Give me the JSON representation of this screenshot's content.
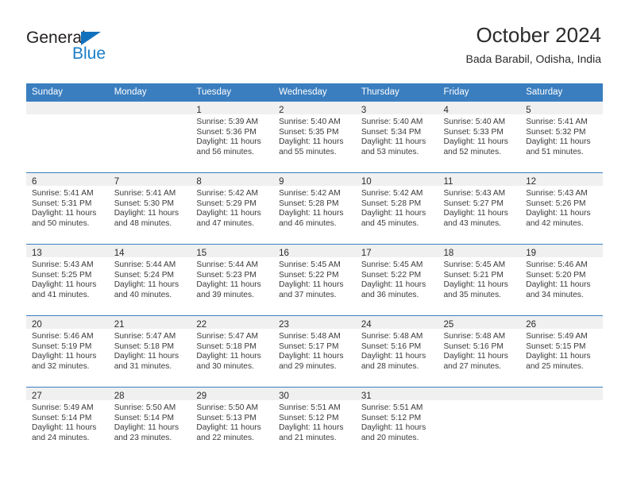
{
  "brand": {
    "name_top": "General",
    "name_bottom": "Blue",
    "triangle_color": "#1271bd",
    "blue_text_color": "#1a7ec6"
  },
  "header": {
    "title": "October 2024",
    "subtitle": "Bada Barabil, Odisha, India",
    "accent_color": "#3a7ebf",
    "band_color": "#f0f0f0"
  },
  "weekday_headers": [
    "Sunday",
    "Monday",
    "Tuesday",
    "Wednesday",
    "Thursday",
    "Friday",
    "Saturday"
  ],
  "weeks": [
    [
      {
        "day": ""
      },
      {
        "day": ""
      },
      {
        "day": "1",
        "sunrise": "Sunrise: 5:39 AM",
        "sunset": "Sunset: 5:36 PM",
        "daylight_line1": "Daylight: 11 hours",
        "daylight_line2": "and 56 minutes."
      },
      {
        "day": "2",
        "sunrise": "Sunrise: 5:40 AM",
        "sunset": "Sunset: 5:35 PM",
        "daylight_line1": "Daylight: 11 hours",
        "daylight_line2": "and 55 minutes."
      },
      {
        "day": "3",
        "sunrise": "Sunrise: 5:40 AM",
        "sunset": "Sunset: 5:34 PM",
        "daylight_line1": "Daylight: 11 hours",
        "daylight_line2": "and 53 minutes."
      },
      {
        "day": "4",
        "sunrise": "Sunrise: 5:40 AM",
        "sunset": "Sunset: 5:33 PM",
        "daylight_line1": "Daylight: 11 hours",
        "daylight_line2": "and 52 minutes."
      },
      {
        "day": "5",
        "sunrise": "Sunrise: 5:41 AM",
        "sunset": "Sunset: 5:32 PM",
        "daylight_line1": "Daylight: 11 hours",
        "daylight_line2": "and 51 minutes."
      }
    ],
    [
      {
        "day": "6",
        "sunrise": "Sunrise: 5:41 AM",
        "sunset": "Sunset: 5:31 PM",
        "daylight_line1": "Daylight: 11 hours",
        "daylight_line2": "and 50 minutes."
      },
      {
        "day": "7",
        "sunrise": "Sunrise: 5:41 AM",
        "sunset": "Sunset: 5:30 PM",
        "daylight_line1": "Daylight: 11 hours",
        "daylight_line2": "and 48 minutes."
      },
      {
        "day": "8",
        "sunrise": "Sunrise: 5:42 AM",
        "sunset": "Sunset: 5:29 PM",
        "daylight_line1": "Daylight: 11 hours",
        "daylight_line2": "and 47 minutes."
      },
      {
        "day": "9",
        "sunrise": "Sunrise: 5:42 AM",
        "sunset": "Sunset: 5:28 PM",
        "daylight_line1": "Daylight: 11 hours",
        "daylight_line2": "and 46 minutes."
      },
      {
        "day": "10",
        "sunrise": "Sunrise: 5:42 AM",
        "sunset": "Sunset: 5:28 PM",
        "daylight_line1": "Daylight: 11 hours",
        "daylight_line2": "and 45 minutes."
      },
      {
        "day": "11",
        "sunrise": "Sunrise: 5:43 AM",
        "sunset": "Sunset: 5:27 PM",
        "daylight_line1": "Daylight: 11 hours",
        "daylight_line2": "and 43 minutes."
      },
      {
        "day": "12",
        "sunrise": "Sunrise: 5:43 AM",
        "sunset": "Sunset: 5:26 PM",
        "daylight_line1": "Daylight: 11 hours",
        "daylight_line2": "and 42 minutes."
      }
    ],
    [
      {
        "day": "13",
        "sunrise": "Sunrise: 5:43 AM",
        "sunset": "Sunset: 5:25 PM",
        "daylight_line1": "Daylight: 11 hours",
        "daylight_line2": "and 41 minutes."
      },
      {
        "day": "14",
        "sunrise": "Sunrise: 5:44 AM",
        "sunset": "Sunset: 5:24 PM",
        "daylight_line1": "Daylight: 11 hours",
        "daylight_line2": "and 40 minutes."
      },
      {
        "day": "15",
        "sunrise": "Sunrise: 5:44 AM",
        "sunset": "Sunset: 5:23 PM",
        "daylight_line1": "Daylight: 11 hours",
        "daylight_line2": "and 39 minutes."
      },
      {
        "day": "16",
        "sunrise": "Sunrise: 5:45 AM",
        "sunset": "Sunset: 5:22 PM",
        "daylight_line1": "Daylight: 11 hours",
        "daylight_line2": "and 37 minutes."
      },
      {
        "day": "17",
        "sunrise": "Sunrise: 5:45 AM",
        "sunset": "Sunset: 5:22 PM",
        "daylight_line1": "Daylight: 11 hours",
        "daylight_line2": "and 36 minutes."
      },
      {
        "day": "18",
        "sunrise": "Sunrise: 5:45 AM",
        "sunset": "Sunset: 5:21 PM",
        "daylight_line1": "Daylight: 11 hours",
        "daylight_line2": "and 35 minutes."
      },
      {
        "day": "19",
        "sunrise": "Sunrise: 5:46 AM",
        "sunset": "Sunset: 5:20 PM",
        "daylight_line1": "Daylight: 11 hours",
        "daylight_line2": "and 34 minutes."
      }
    ],
    [
      {
        "day": "20",
        "sunrise": "Sunrise: 5:46 AM",
        "sunset": "Sunset: 5:19 PM",
        "daylight_line1": "Daylight: 11 hours",
        "daylight_line2": "and 32 minutes."
      },
      {
        "day": "21",
        "sunrise": "Sunrise: 5:47 AM",
        "sunset": "Sunset: 5:18 PM",
        "daylight_line1": "Daylight: 11 hours",
        "daylight_line2": "and 31 minutes."
      },
      {
        "day": "22",
        "sunrise": "Sunrise: 5:47 AM",
        "sunset": "Sunset: 5:18 PM",
        "daylight_line1": "Daylight: 11 hours",
        "daylight_line2": "and 30 minutes."
      },
      {
        "day": "23",
        "sunrise": "Sunrise: 5:48 AM",
        "sunset": "Sunset: 5:17 PM",
        "daylight_line1": "Daylight: 11 hours",
        "daylight_line2": "and 29 minutes."
      },
      {
        "day": "24",
        "sunrise": "Sunrise: 5:48 AM",
        "sunset": "Sunset: 5:16 PM",
        "daylight_line1": "Daylight: 11 hours",
        "daylight_line2": "and 28 minutes."
      },
      {
        "day": "25",
        "sunrise": "Sunrise: 5:48 AM",
        "sunset": "Sunset: 5:16 PM",
        "daylight_line1": "Daylight: 11 hours",
        "daylight_line2": "and 27 minutes."
      },
      {
        "day": "26",
        "sunrise": "Sunrise: 5:49 AM",
        "sunset": "Sunset: 5:15 PM",
        "daylight_line1": "Daylight: 11 hours",
        "daylight_line2": "and 25 minutes."
      }
    ],
    [
      {
        "day": "27",
        "sunrise": "Sunrise: 5:49 AM",
        "sunset": "Sunset: 5:14 PM",
        "daylight_line1": "Daylight: 11 hours",
        "daylight_line2": "and 24 minutes."
      },
      {
        "day": "28",
        "sunrise": "Sunrise: 5:50 AM",
        "sunset": "Sunset: 5:14 PM",
        "daylight_line1": "Daylight: 11 hours",
        "daylight_line2": "and 23 minutes."
      },
      {
        "day": "29",
        "sunrise": "Sunrise: 5:50 AM",
        "sunset": "Sunset: 5:13 PM",
        "daylight_line1": "Daylight: 11 hours",
        "daylight_line2": "and 22 minutes."
      },
      {
        "day": "30",
        "sunrise": "Sunrise: 5:51 AM",
        "sunset": "Sunset: 5:12 PM",
        "daylight_line1": "Daylight: 11 hours",
        "daylight_line2": "and 21 minutes."
      },
      {
        "day": "31",
        "sunrise": "Sunrise: 5:51 AM",
        "sunset": "Sunset: 5:12 PM",
        "daylight_line1": "Daylight: 11 hours",
        "daylight_line2": "and 20 minutes."
      },
      {
        "day": ""
      },
      {
        "day": ""
      }
    ]
  ]
}
